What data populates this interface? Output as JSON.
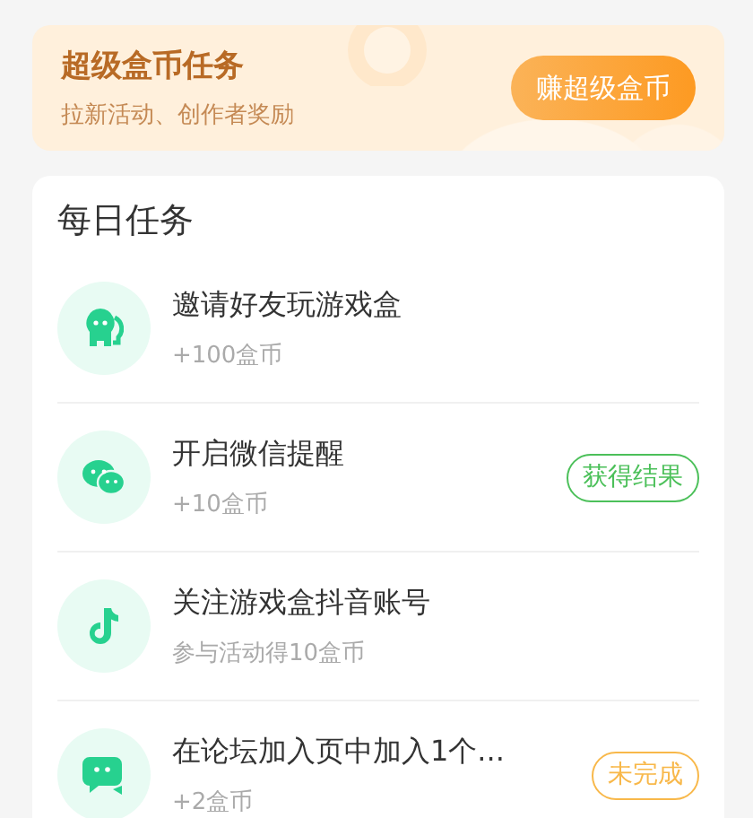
{
  "banner": {
    "title": "超级盒币任务",
    "subtitle": "拉新活动、创作者奖励",
    "button": "赚超级盒币"
  },
  "daily_tasks": {
    "title": "每日任务",
    "items": [
      {
        "kind": "mascot",
        "title": "邀请好友玩游戏盒",
        "reward": "+100盒币"
      },
      {
        "kind": "wechat",
        "title": "开启微信提醒",
        "reward": "+10盒币",
        "status": {
          "kind": "result",
          "label": "获得结果"
        }
      },
      {
        "kind": "note",
        "title": "关注游戏盒抖音账号",
        "reward": "参与活动得10盒币"
      },
      {
        "kind": "chat",
        "title": "在论坛加入页中加入1个...",
        "reward": "+2盒币",
        "status": {
          "kind": "pending",
          "label": "未完成"
        }
      }
    ]
  }
}
